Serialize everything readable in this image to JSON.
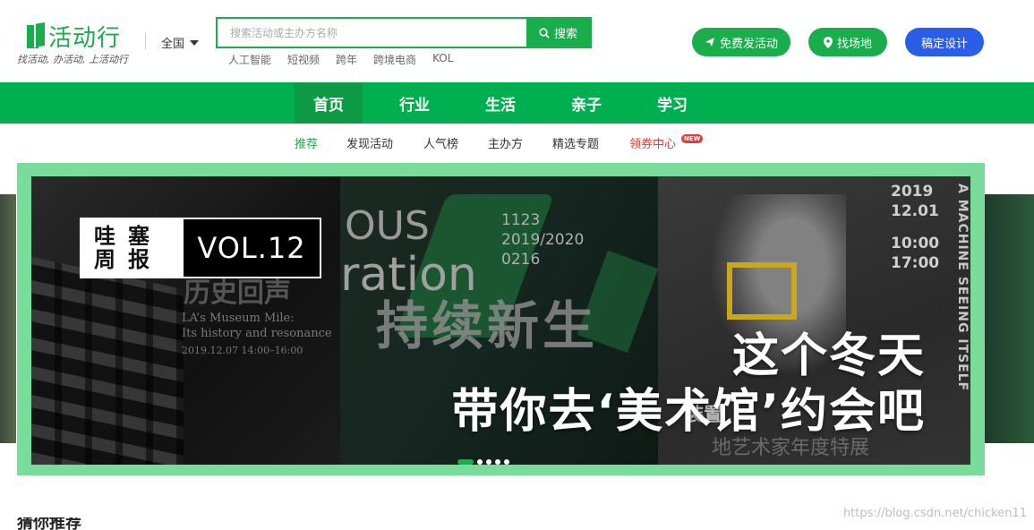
{
  "logo": {
    "text": "活动行",
    "slogan": "找活动, 办活动, 上活动行"
  },
  "region": {
    "label": "全国"
  },
  "search": {
    "placeholder": "搜索活动或主办方名称",
    "button_label": "搜索"
  },
  "hot_keywords": [
    "人工智能",
    "短视频",
    "跨年",
    "跨境电商",
    "KOL"
  ],
  "actions": {
    "publish": "免费发活动",
    "venue": "找场地",
    "design": "稿定设计"
  },
  "main_nav": [
    "首页",
    "行业",
    "生活",
    "亲子",
    "学习"
  ],
  "sub_nav": [
    "推荐",
    "发现活动",
    "人气榜",
    "主办方",
    "精选专题",
    "领券中心"
  ],
  "sub_nav_badge": "NEW",
  "banner": {
    "vol_left_top": "哇塞",
    "vol_left_bottom": "周报",
    "vol_right": "VOL.12",
    "headline1": "这个冬天",
    "headline2": "带你去‘美术馆’约会吧",
    "p1_cn": "历史回声",
    "p1_en1": "LA’s Museum Mile:",
    "p1_en2": "Its history and resonance",
    "p1_date": "2019.12.07 14:00–16:00",
    "p2_ous": "OUS",
    "p2_ration": "ration",
    "p2_nums1": "1123",
    "p2_nums2": "2019/2020",
    "p2_nums3": "0216",
    "p2_big": "持续新生",
    "p3_info1": "2019",
    "p3_info2": "12.01",
    "p3_info3": "10:00",
    "p3_info4": "17:00",
    "p3_vertical": "A MACHINE SEEING ITSELF",
    "p3_zh": "装置",
    "p3_zh2": "地艺术家年度特展"
  },
  "carousel": {
    "count": 5,
    "active": 0
  },
  "watermark": "https://blog.csdn.net/chicken11",
  "section_title": "猜你推荐"
}
